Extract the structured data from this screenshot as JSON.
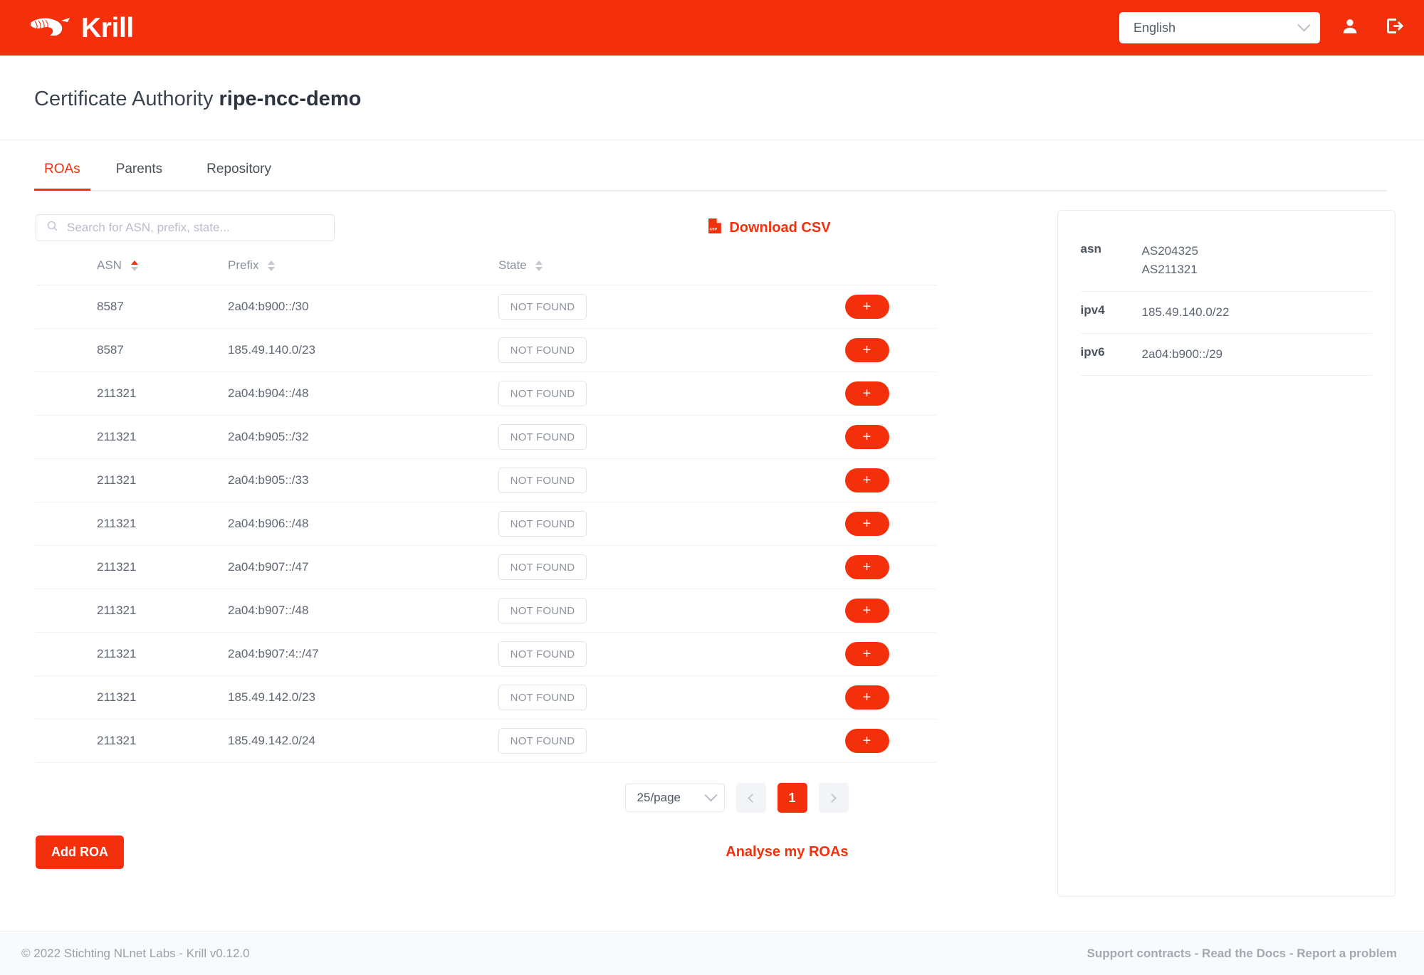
{
  "header": {
    "brand_name": "Krill",
    "brand_logo_icon": "krill-logo-icon",
    "language_value": "English",
    "language_options": [
      "English"
    ],
    "account_icon": "user-icon",
    "logout_icon": "logout-icon"
  },
  "page": {
    "title_prefix": "Certificate Authority ",
    "title_ca_name": "ripe-ncc-demo"
  },
  "tabs": [
    {
      "label": "ROAs",
      "active": true
    },
    {
      "label": "Parents",
      "active": false
    },
    {
      "label": "Repository",
      "active": false
    }
  ],
  "toolbar": {
    "search_placeholder": "Search for ASN, prefix, state...",
    "search_value": "",
    "search_icon": "search-icon",
    "download_csv_label": "Download CSV",
    "download_csv_icon": "csv-file-icon"
  },
  "table": {
    "columns": [
      {
        "label": "ASN",
        "sort": "asc"
      },
      {
        "label": "Prefix",
        "sort": "none"
      },
      {
        "label": "State",
        "sort": "none"
      }
    ],
    "rows": [
      {
        "asn": "8587",
        "prefix": "2a04:b900::/30",
        "state": "NOT FOUND",
        "action": "+"
      },
      {
        "asn": "8587",
        "prefix": "185.49.140.0/23",
        "state": "NOT FOUND",
        "action": "+"
      },
      {
        "asn": "211321",
        "prefix": "2a04:b904::/48",
        "state": "NOT FOUND",
        "action": "+"
      },
      {
        "asn": "211321",
        "prefix": "2a04:b905::/32",
        "state": "NOT FOUND",
        "action": "+"
      },
      {
        "asn": "211321",
        "prefix": "2a04:b905::/33",
        "state": "NOT FOUND",
        "action": "+"
      },
      {
        "asn": "211321",
        "prefix": "2a04:b906::/48",
        "state": "NOT FOUND",
        "action": "+"
      },
      {
        "asn": "211321",
        "prefix": "2a04:b907::/47",
        "state": "NOT FOUND",
        "action": "+"
      },
      {
        "asn": "211321",
        "prefix": "2a04:b907::/48",
        "state": "NOT FOUND",
        "action": "+"
      },
      {
        "asn": "211321",
        "prefix": "2a04:b907:4::/47",
        "state": "NOT FOUND",
        "action": "+"
      },
      {
        "asn": "211321",
        "prefix": "185.49.142.0/23",
        "state": "NOT FOUND",
        "action": "+"
      },
      {
        "asn": "211321",
        "prefix": "185.49.142.0/24",
        "state": "NOT FOUND",
        "action": "+"
      }
    ]
  },
  "pagination": {
    "per_page_value": "25/page",
    "per_page_options": [
      "25/page"
    ],
    "prev_label": "‹",
    "next_label": "›",
    "pages": [
      "1"
    ],
    "current_page": "1"
  },
  "actions": {
    "add_roa_label": "Add ROA",
    "analyse_label": "Analyse my ROAs"
  },
  "resources": [
    {
      "key": "asn",
      "value": "AS204325\nAS211321"
    },
    {
      "key": "ipv4",
      "value": "185.49.140.0/22"
    },
    {
      "key": "ipv6",
      "value": "2a04:b900::/29"
    }
  ],
  "footer": {
    "copyright": "© 2022 Stichting NLnet Labs - Krill v0.12.0",
    "link_support": "Support contracts",
    "link_docs": "Read the Docs",
    "link_report": "Report a problem",
    "link_sep": " - "
  },
  "colors": {
    "brand_red": "#F4300C",
    "text_dark": "#3c4450",
    "text_muted": "#8a919e",
    "border_light": "#eceef3"
  }
}
